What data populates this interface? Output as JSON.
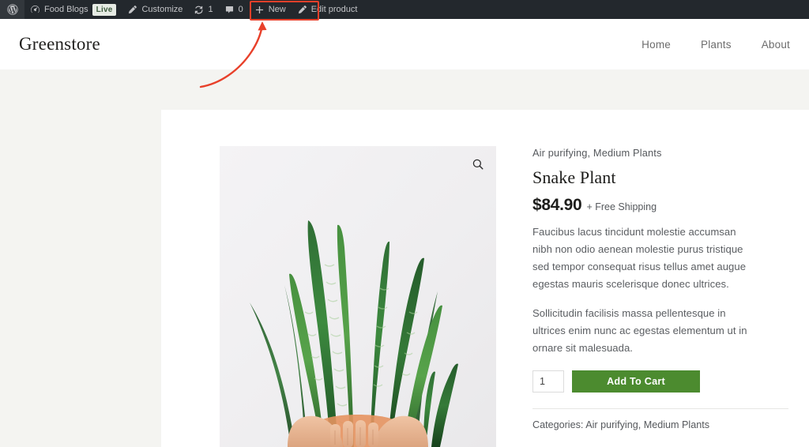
{
  "admin_bar": {
    "logo_icon": "wordpress-logo-icon",
    "items": [
      {
        "id": "site-name",
        "icon": "dashboard-icon",
        "label": "Food Blogs",
        "badge": "Live"
      },
      {
        "id": "customize",
        "icon": "pencil-icon",
        "label": "Customize"
      },
      {
        "id": "updates",
        "icon": "update-arrows-icon",
        "label": "1"
      },
      {
        "id": "comments",
        "icon": "comment-bubble-icon",
        "label": "0"
      },
      {
        "id": "new-content",
        "icon": "plus-icon",
        "label": "New"
      },
      {
        "id": "edit-product",
        "icon": "pencil-icon",
        "label": "Edit product"
      }
    ]
  },
  "annotation": {
    "highlight_color": "#e8402a",
    "target_label": "Edit product"
  },
  "header": {
    "brand": "Greenstore",
    "nav": [
      {
        "label": "Home"
      },
      {
        "label": "Plants"
      },
      {
        "label": "About"
      }
    ]
  },
  "product": {
    "gallery": {
      "zoom_icon": "magnifying-glass-icon",
      "image_alt": "Snake Plant held by two hands against a light background"
    },
    "breadcrumb": "Air purifying, Medium Plants",
    "title": "Snake Plant",
    "price": "$84.90",
    "shipping": "+ Free Shipping",
    "description_1": "Faucibus lacus tincidunt molestie accumsan nibh non odio aenean molestie purus tristique sed tempor consequat risus tellus amet augue egestas mauris scelerisque donec ultrices.",
    "description_2": "Sollicitudin facilisis massa pellentesque in ultrices enim nunc ac egestas elementum ut in ornare sit malesuada.",
    "quantity": "1",
    "add_to_cart_label": "Add To Cart",
    "add_to_cart_color": "#4c8b2f",
    "categories_label": "Categories:",
    "categories": [
      {
        "label": "Air purifying"
      },
      {
        "label": "Medium Plants"
      }
    ],
    "categories_text": "Categories: Air purifying, Medium Plants"
  }
}
